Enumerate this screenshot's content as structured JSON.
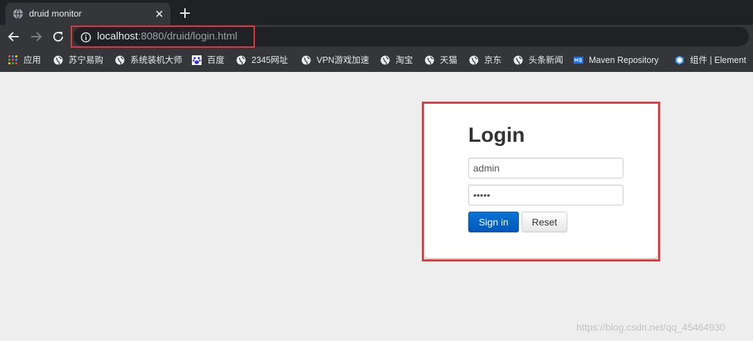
{
  "browser": {
    "tab": {
      "title": "druid monitor",
      "favicon": "globe-icon",
      "close_icon": "close-icon"
    },
    "new_tab_icon": "plus-icon",
    "nav": {
      "back": "arrow-left-icon",
      "forward": "arrow-right-icon",
      "reload": "reload-icon"
    },
    "address": {
      "host": "localhost",
      "rest": ":8080/druid/login.html",
      "info_icon": "info-icon"
    },
    "bookmarks": [
      {
        "label": "应用",
        "icon": "apps-grid-icon"
      },
      {
        "label": "苏宁易购",
        "icon": "globe-icon"
      },
      {
        "label": "系统装机大师",
        "icon": "globe-icon"
      },
      {
        "label": "百度",
        "icon": "baidu-paw-icon"
      },
      {
        "label": "2345网址",
        "icon": "globe-icon"
      },
      {
        "label": "VPN游戏加速",
        "icon": "globe-icon"
      },
      {
        "label": "淘宝",
        "icon": "globe-icon"
      },
      {
        "label": "天猫",
        "icon": "globe-icon"
      },
      {
        "label": "京东",
        "icon": "globe-icon"
      },
      {
        "label": "头条新闻",
        "icon": "globe-icon"
      },
      {
        "label": "Maven Repository",
        "icon": "maven-icon"
      },
      {
        "label": "组件 | Element",
        "icon": "element-hex-icon"
      }
    ]
  },
  "login": {
    "title": "Login",
    "username": {
      "value": "admin"
    },
    "password": {
      "value": "•••••"
    },
    "sign_in": "Sign in",
    "reset": "Reset"
  },
  "watermark": "https://blog.csdn.net/qq_45464930",
  "colors": {
    "highlight": "#e0393e",
    "primary_button": "#0a6fd0",
    "page_bg": "#eeeeee"
  }
}
